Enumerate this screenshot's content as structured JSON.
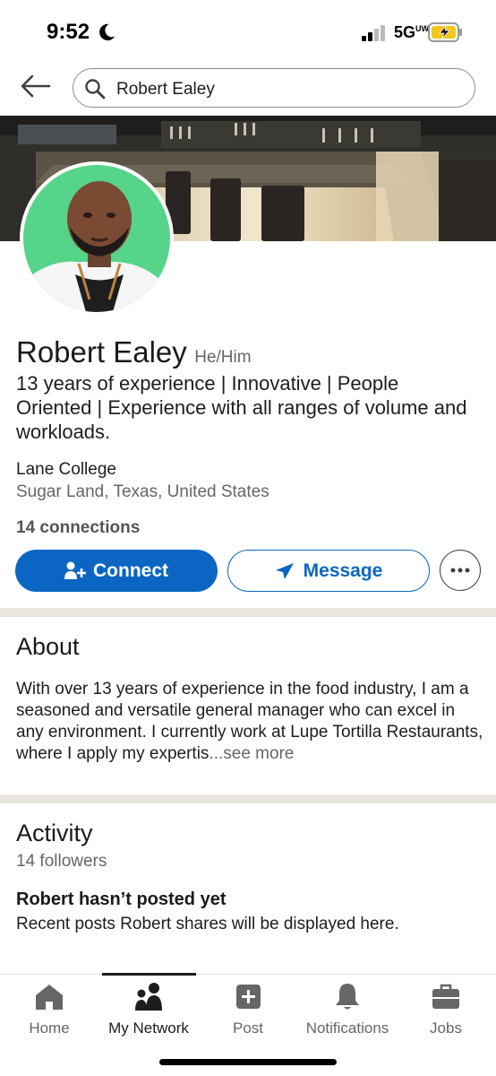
{
  "status_bar": {
    "time": "9:52",
    "network": "5G",
    "network_sub": "UW"
  },
  "search": {
    "query": "Robert Ealey"
  },
  "profile": {
    "name": "Robert Ealey",
    "pronouns": "He/Him",
    "headline": "13 years of experience | Innovative | People Oriented | Experience with all ranges of volume and workloads.",
    "school": "Lane College",
    "location": "Sugar Land, Texas, United States",
    "connections": "14 connections"
  },
  "actions": {
    "connect": "Connect",
    "message": "Message"
  },
  "about": {
    "title": "About",
    "text": "With over 13  years of experience in the food industry, I am a seasoned and versatile general manager who can excel in any environment. I currently work at Lupe Tortilla Restaurants, where I apply my expertis",
    "see_more": "...see more"
  },
  "activity": {
    "title": "Activity",
    "followers": "14 followers",
    "empty_title": "Robert hasn’t posted yet",
    "empty_sub": "Recent posts Robert shares will be displayed here."
  },
  "nav": {
    "items": [
      {
        "label": "Home",
        "icon": "home-icon"
      },
      {
        "label": "My Network",
        "icon": "network-icon"
      },
      {
        "label": "Post",
        "icon": "post-icon"
      },
      {
        "label": "Notifications",
        "icon": "bell-icon"
      },
      {
        "label": "Jobs",
        "icon": "briefcase-icon"
      }
    ],
    "active": "My Network"
  },
  "colors": {
    "brand_blue": "#0a66c2",
    "avatar_bg": "#56d489",
    "divider": "#e9e5df"
  }
}
